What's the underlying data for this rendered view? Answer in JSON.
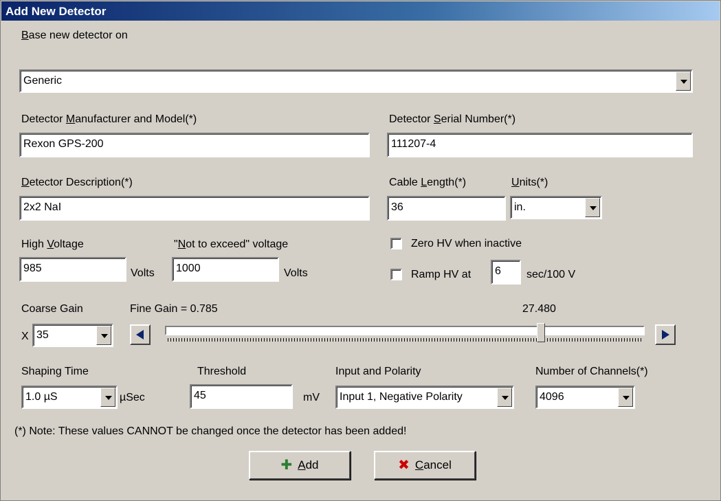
{
  "window": {
    "title": "Add New Detector"
  },
  "base": {
    "label_u": "B",
    "label_rest": "ase new detector on",
    "value": "Generic"
  },
  "manufacturer": {
    "label_pre": "Detector ",
    "label_u": "M",
    "label_post": "anufacturer and Model(*)",
    "value": "Rexon GPS-200"
  },
  "serial": {
    "label_pre": "Detector ",
    "label_u": "S",
    "label_post": "erial Number(*)",
    "value": "111207-4"
  },
  "description": {
    "label_u": "D",
    "label_post": "etector Description(*)",
    "value": "2x2 NaI"
  },
  "cable": {
    "label_pre": "Cable ",
    "label_u": "L",
    "label_post": "ength(*)",
    "value": "36"
  },
  "units": {
    "label_u": "U",
    "label_post": "nits(*)",
    "value": "in."
  },
  "hv": {
    "label_pre": "High ",
    "label_u": "V",
    "label_post": "oltage",
    "value": "985",
    "unit": "Volts"
  },
  "hv_max": {
    "label_pre": "\"",
    "label_u": "N",
    "label_post": "ot to exceed\" voltage",
    "value": "1000",
    "unit": "Volts"
  },
  "zero_hv": {
    "label": "Zero HV when inactive",
    "checked": false
  },
  "ramp": {
    "label": "Ramp HV at",
    "value": "6",
    "unit": "sec/100 V",
    "checked": false
  },
  "coarse": {
    "label": "Coarse Gain",
    "prefix": "X",
    "value": "35"
  },
  "fine": {
    "label": "Fine Gain = 0.785",
    "readout": "27.480",
    "position_fraction": 0.785
  },
  "shaping": {
    "label": "Shaping Time",
    "value": "1.0 µS",
    "unit": "µSec"
  },
  "threshold": {
    "label": "Threshold",
    "value": "45",
    "unit": "mV"
  },
  "input": {
    "label": "Input and Polarity",
    "value": "Input 1, Negative Polarity"
  },
  "channels": {
    "label": "Number of Channels(*)",
    "value": "4096"
  },
  "note": "(*) Note:  These values CANNOT be changed once the detector has been added!",
  "buttons": {
    "add_u": "A",
    "add_rest": "dd",
    "cancel_u": "C",
    "cancel_rest": "ancel"
  },
  "colors": {
    "title_start": "#0a246a",
    "title_end": "#a6caf0",
    "face": "#d4d0c8",
    "arrow": "#0a246a",
    "add_icon": "#2e7d32",
    "cancel_icon": "#cc0000"
  }
}
